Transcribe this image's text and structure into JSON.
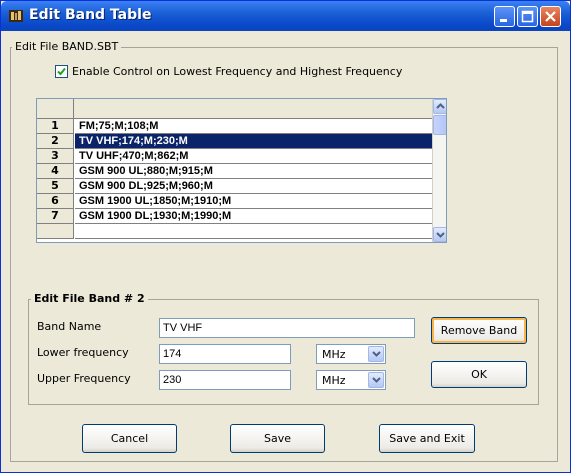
{
  "window": {
    "title": "Edit Band Table",
    "file_group_label": "Edit File BAND.SBT",
    "enable_control_label": "Enable Control on Lowest Frequency and Highest Frequency",
    "enable_control_checked": true
  },
  "band_table": {
    "rows": [
      {
        "num": "1",
        "value": "FM;75;M;108;M"
      },
      {
        "num": "2",
        "value": "TV VHF;174;M;230;M",
        "selected": true
      },
      {
        "num": "3",
        "value": "TV UHF;470;M;862;M"
      },
      {
        "num": "4",
        "value": "GSM 900 UL;880;M;915;M"
      },
      {
        "num": "5",
        "value": "GSM 900 DL;925;M;960;M"
      },
      {
        "num": "6",
        "value": "GSM 1900 UL;1850;M;1910;M"
      },
      {
        "num": "7",
        "value": "GSM 1900 DL;1930;M;1990;M"
      }
    ]
  },
  "edit_band": {
    "group_label": "Edit File Band # 2",
    "band_name_label": "Band Name",
    "band_name_value": "TV VHF",
    "lower_label": "Lower frequency",
    "lower_value": "174",
    "lower_unit": "MHz",
    "upper_label": "Upper Frequency",
    "upper_value": "230",
    "upper_unit": "MHz",
    "remove_button": "Remove Band",
    "ok_button": "OK"
  },
  "footer": {
    "cancel_button": "Cancel",
    "save_button": "Save",
    "save_exit_button": "Save and Exit"
  }
}
